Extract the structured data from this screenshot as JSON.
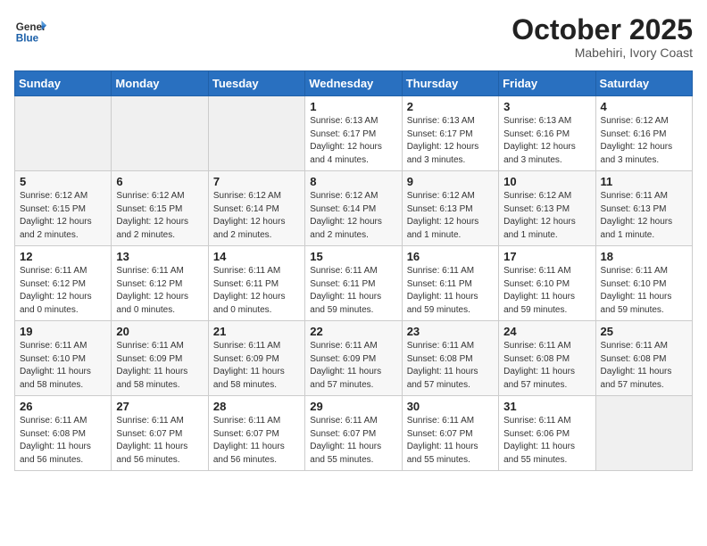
{
  "logo": {
    "line1": "General",
    "line2": "Blue"
  },
  "title": "October 2025",
  "subtitle": "Mabehiri, Ivory Coast",
  "days_of_week": [
    "Sunday",
    "Monday",
    "Tuesday",
    "Wednesday",
    "Thursday",
    "Friday",
    "Saturday"
  ],
  "weeks": [
    [
      {
        "day": "",
        "info": ""
      },
      {
        "day": "",
        "info": ""
      },
      {
        "day": "",
        "info": ""
      },
      {
        "day": "1",
        "info": "Sunrise: 6:13 AM\nSunset: 6:17 PM\nDaylight: 12 hours\nand 4 minutes."
      },
      {
        "day": "2",
        "info": "Sunrise: 6:13 AM\nSunset: 6:17 PM\nDaylight: 12 hours\nand 3 minutes."
      },
      {
        "day": "3",
        "info": "Sunrise: 6:13 AM\nSunset: 6:16 PM\nDaylight: 12 hours\nand 3 minutes."
      },
      {
        "day": "4",
        "info": "Sunrise: 6:12 AM\nSunset: 6:16 PM\nDaylight: 12 hours\nand 3 minutes."
      }
    ],
    [
      {
        "day": "5",
        "info": "Sunrise: 6:12 AM\nSunset: 6:15 PM\nDaylight: 12 hours\nand 2 minutes."
      },
      {
        "day": "6",
        "info": "Sunrise: 6:12 AM\nSunset: 6:15 PM\nDaylight: 12 hours\nand 2 minutes."
      },
      {
        "day": "7",
        "info": "Sunrise: 6:12 AM\nSunset: 6:14 PM\nDaylight: 12 hours\nand 2 minutes."
      },
      {
        "day": "8",
        "info": "Sunrise: 6:12 AM\nSunset: 6:14 PM\nDaylight: 12 hours\nand 2 minutes."
      },
      {
        "day": "9",
        "info": "Sunrise: 6:12 AM\nSunset: 6:13 PM\nDaylight: 12 hours\nand 1 minute."
      },
      {
        "day": "10",
        "info": "Sunrise: 6:12 AM\nSunset: 6:13 PM\nDaylight: 12 hours\nand 1 minute."
      },
      {
        "day": "11",
        "info": "Sunrise: 6:11 AM\nSunset: 6:13 PM\nDaylight: 12 hours\nand 1 minute."
      }
    ],
    [
      {
        "day": "12",
        "info": "Sunrise: 6:11 AM\nSunset: 6:12 PM\nDaylight: 12 hours\nand 0 minutes."
      },
      {
        "day": "13",
        "info": "Sunrise: 6:11 AM\nSunset: 6:12 PM\nDaylight: 12 hours\nand 0 minutes."
      },
      {
        "day": "14",
        "info": "Sunrise: 6:11 AM\nSunset: 6:11 PM\nDaylight: 12 hours\nand 0 minutes."
      },
      {
        "day": "15",
        "info": "Sunrise: 6:11 AM\nSunset: 6:11 PM\nDaylight: 11 hours\nand 59 minutes."
      },
      {
        "day": "16",
        "info": "Sunrise: 6:11 AM\nSunset: 6:11 PM\nDaylight: 11 hours\nand 59 minutes."
      },
      {
        "day": "17",
        "info": "Sunrise: 6:11 AM\nSunset: 6:10 PM\nDaylight: 11 hours\nand 59 minutes."
      },
      {
        "day": "18",
        "info": "Sunrise: 6:11 AM\nSunset: 6:10 PM\nDaylight: 11 hours\nand 59 minutes."
      }
    ],
    [
      {
        "day": "19",
        "info": "Sunrise: 6:11 AM\nSunset: 6:10 PM\nDaylight: 11 hours\nand 58 minutes."
      },
      {
        "day": "20",
        "info": "Sunrise: 6:11 AM\nSunset: 6:09 PM\nDaylight: 11 hours\nand 58 minutes."
      },
      {
        "day": "21",
        "info": "Sunrise: 6:11 AM\nSunset: 6:09 PM\nDaylight: 11 hours\nand 58 minutes."
      },
      {
        "day": "22",
        "info": "Sunrise: 6:11 AM\nSunset: 6:09 PM\nDaylight: 11 hours\nand 57 minutes."
      },
      {
        "day": "23",
        "info": "Sunrise: 6:11 AM\nSunset: 6:08 PM\nDaylight: 11 hours\nand 57 minutes."
      },
      {
        "day": "24",
        "info": "Sunrise: 6:11 AM\nSunset: 6:08 PM\nDaylight: 11 hours\nand 57 minutes."
      },
      {
        "day": "25",
        "info": "Sunrise: 6:11 AM\nSunset: 6:08 PM\nDaylight: 11 hours\nand 57 minutes."
      }
    ],
    [
      {
        "day": "26",
        "info": "Sunrise: 6:11 AM\nSunset: 6:08 PM\nDaylight: 11 hours\nand 56 minutes."
      },
      {
        "day": "27",
        "info": "Sunrise: 6:11 AM\nSunset: 6:07 PM\nDaylight: 11 hours\nand 56 minutes."
      },
      {
        "day": "28",
        "info": "Sunrise: 6:11 AM\nSunset: 6:07 PM\nDaylight: 11 hours\nand 56 minutes."
      },
      {
        "day": "29",
        "info": "Sunrise: 6:11 AM\nSunset: 6:07 PM\nDaylight: 11 hours\nand 55 minutes."
      },
      {
        "day": "30",
        "info": "Sunrise: 6:11 AM\nSunset: 6:07 PM\nDaylight: 11 hours\nand 55 minutes."
      },
      {
        "day": "31",
        "info": "Sunrise: 6:11 AM\nSunset: 6:06 PM\nDaylight: 11 hours\nand 55 minutes."
      },
      {
        "day": "",
        "info": ""
      }
    ]
  ]
}
